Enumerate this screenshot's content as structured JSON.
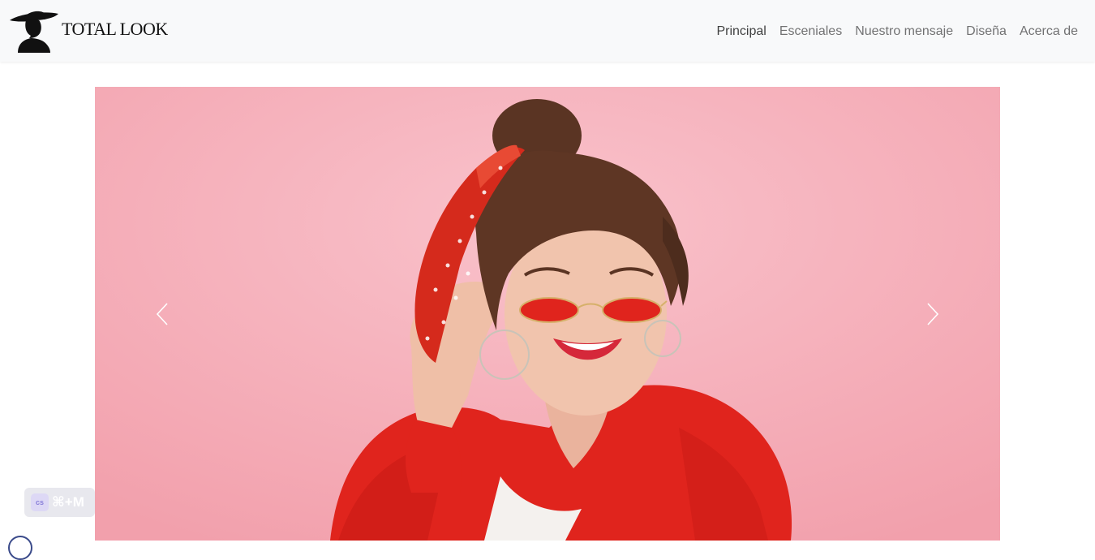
{
  "brand": {
    "name": "TOTAL LOOK",
    "logo_icon": "woman-in-hat-silhouette-logo"
  },
  "nav": {
    "items": [
      {
        "label": "Principal",
        "active": true
      },
      {
        "label": "Esceniales",
        "active": false
      },
      {
        "label": "Nuestro mensaje",
        "active": false
      },
      {
        "label": "Diseña",
        "active": false
      },
      {
        "label": "Acerca de",
        "active": false
      }
    ]
  },
  "carousel": {
    "prev_icon": "chevron-left-icon",
    "next_icon": "chevron-right-icon",
    "background_color": "#f4a7b3"
  },
  "extension_badge": {
    "icon_text": "cs",
    "shortcut": "⌘+M"
  },
  "colors": {
    "navbar_bg": "#f8f9fa",
    "accent_red": "#e32a22",
    "pink_bg": "#f4a7b3"
  }
}
